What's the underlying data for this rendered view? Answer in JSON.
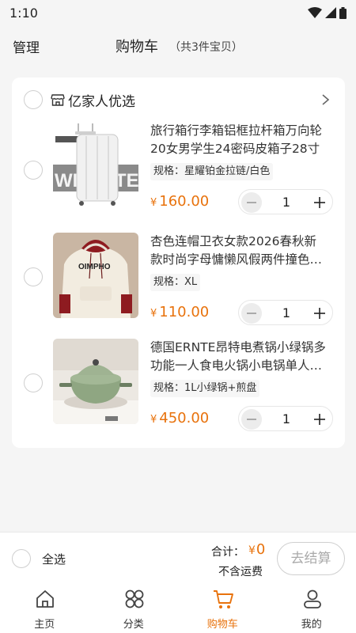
{
  "status_bar": {
    "time": "1:10"
  },
  "header": {
    "manage": "管理",
    "title": "购物车",
    "count": "（共3件宝贝）"
  },
  "store": {
    "name": "亿家人优选"
  },
  "items": [
    {
      "title_line1": "旅行箱行李箱铝框拉杆箱万向轮",
      "title_line2": "20女男学生24密码皮箱子28寸",
      "spec": "规格：星耀铂金拉链/白色",
      "yen": "¥",
      "price": "160.00",
      "qty": "1",
      "image": "white-suitcase"
    },
    {
      "title_line1": "杏色连帽卫衣女款2026春秋新",
      "title_line2": "款时尚字母慵懒风假两件撞色…",
      "spec": "规格：XL",
      "yen": "¥",
      "price": "110.00",
      "qty": "1",
      "image": "hoodie"
    },
    {
      "title_line1": "德国ERNTE昂特电煮锅小绿锅多",
      "title_line2": "功能一人食电火锅小电锅单人…",
      "spec": "规格：1L小绿锅+煎盘",
      "yen": "¥",
      "price": "450.00",
      "qty": "1",
      "image": "green-electric-pot"
    }
  ],
  "checkout": {
    "select_all": "全选",
    "total_label": "合计：",
    "yen": "¥",
    "total_value": "0",
    "shipping": "不含运费",
    "checkout_button": "去结算"
  },
  "tabbar": [
    {
      "label": "主页",
      "icon": "home-icon"
    },
    {
      "label": "分类",
      "icon": "category-icon"
    },
    {
      "label": "购物车",
      "icon": "cart-icon",
      "active": true
    },
    {
      "label": "我的",
      "icon": "profile-icon"
    }
  ],
  "colors": {
    "accent": "#e8720c",
    "background": "#f5f5f5"
  }
}
